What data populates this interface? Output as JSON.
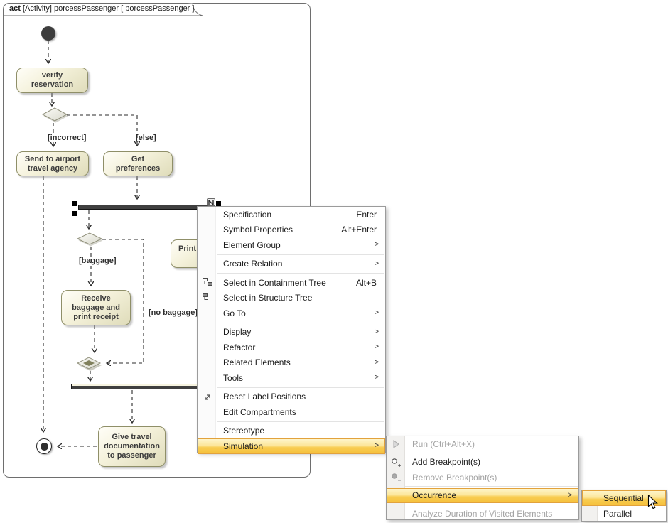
{
  "window": {
    "title_keyword": "act",
    "title_rest": " [Activity] porcessPassenger [ porcessPassenger ]"
  },
  "diagram": {
    "actions": {
      "verify": "verify\nreservation",
      "send": "Send to airport\ntravel agency",
      "get": "Get\npreferences",
      "print": "Print",
      "receive": "Receive\nbaggage and\nprint receipt",
      "give": "Give travel\ndocumentation\nto passenger"
    },
    "guards": {
      "incorrect": "[incorrect]",
      "else": "[else]",
      "baggage": "[baggage]",
      "no_baggage": "[no baggage]"
    }
  },
  "context_menu": {
    "items": [
      {
        "label": "Specification",
        "shortcut": "Enter"
      },
      {
        "label": "Symbol Properties",
        "shortcut": "Alt+Enter"
      },
      {
        "label": "Element Group",
        "submenu": true
      },
      {
        "label": "Create Relation",
        "submenu": true
      },
      {
        "label": "Select in Containment Tree",
        "shortcut": "Alt+B",
        "icon": "containment-tree-icon"
      },
      {
        "label": "Select in Structure Tree",
        "icon": "structure-tree-icon"
      },
      {
        "label": "Go To",
        "submenu": true
      },
      {
        "label": "Display",
        "submenu": true
      },
      {
        "label": "Refactor",
        "submenu": true
      },
      {
        "label": "Related Elements",
        "submenu": true
      },
      {
        "label": "Tools",
        "submenu": true
      },
      {
        "label": "Reset Label Positions",
        "icon": "reset-label-positions-icon"
      },
      {
        "label": "Edit Compartments"
      },
      {
        "label": "Stereotype"
      },
      {
        "label": "Simulation",
        "submenu": true,
        "highlighted": true
      }
    ]
  },
  "simulation_submenu": {
    "items": [
      {
        "label": "Run (Ctrl+Alt+X)",
        "disabled": true,
        "icon": "run-icon"
      },
      {
        "label": "Add Breakpoint(s)",
        "icon": "add-breakpoint-icon"
      },
      {
        "label": "Remove Breakpoint(s)",
        "disabled": true,
        "icon": "remove-breakpoint-icon"
      },
      {
        "label": "Occurrence",
        "submenu": true,
        "highlighted": true
      },
      {
        "label": "Analyze Duration of Visited Elements",
        "disabled": true
      }
    ]
  },
  "occurrence_submenu": {
    "items": [
      {
        "label": "Sequential",
        "highlighted": true
      },
      {
        "label": "Parallel"
      }
    ]
  },
  "icons": {
    "submenu_arrow": ">"
  },
  "colors": {
    "menu_highlight_top": "#fef7d0",
    "menu_highlight_bottom": "#f5bf39",
    "menu_highlight_border": "#e2a23c",
    "action_fill": "#f4f1da",
    "action_border": "#8f8f68",
    "fork_fill": "#3f3f3f"
  }
}
